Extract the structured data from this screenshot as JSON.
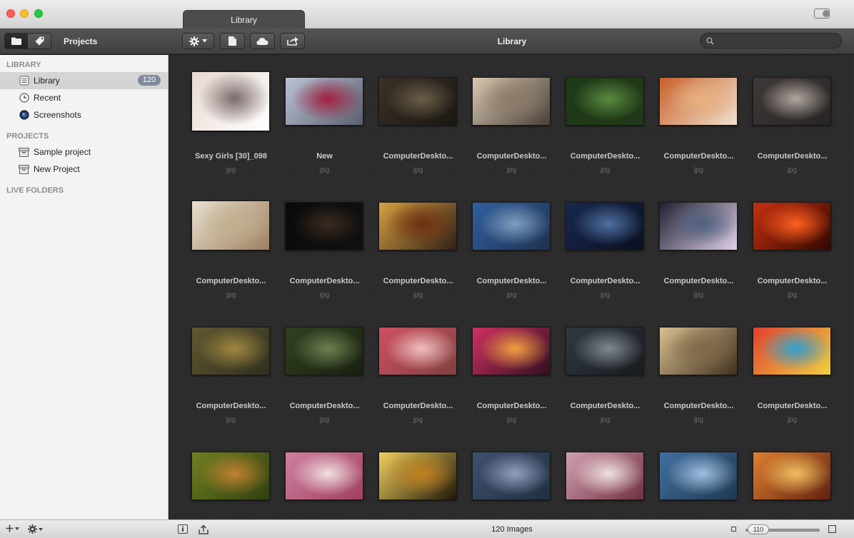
{
  "window": {
    "tab_title": "Library"
  },
  "toolbar": {
    "projects_label": "Projects",
    "title": "Library",
    "search_placeholder": ""
  },
  "sidebar": {
    "library_header": "LIBRARY",
    "library_items": [
      {
        "label": "Library",
        "badge": "120",
        "icon": "library-icon",
        "selected": true
      },
      {
        "label": "Recent",
        "icon": "clock-icon"
      },
      {
        "label": "Screenshots",
        "icon": "screenshots-icon"
      }
    ],
    "projects_header": "PROJECTS",
    "project_items": [
      {
        "label": "Sample project",
        "icon": "project-box-icon"
      },
      {
        "label": "New Project",
        "icon": "project-box-icon"
      }
    ],
    "live_folders_header": "LIVE FOLDERS"
  },
  "grid": {
    "items": [
      {
        "name": "Sexy Girls [30]_098",
        "ext": "jpg",
        "colors": [
          "#e8d8d0",
          "#7a6a6a",
          "#ffffff"
        ]
      },
      {
        "name": "New",
        "ext": "jpg",
        "colors": [
          "#bbc4d6",
          "#a02040",
          "#5a6070"
        ]
      },
      {
        "name": "ComputerDeskto...",
        "ext": "jpg",
        "colors": [
          "#3a3228",
          "#6b5e47",
          "#1a1612"
        ]
      },
      {
        "name": "ComputerDeskto...",
        "ext": "jpg",
        "colors": [
          "#d8c8b0",
          "#8a7a68",
          "#4a4038"
        ]
      },
      {
        "name": "ComputerDeskto...",
        "ext": "jpg",
        "colors": [
          "#1f3a18",
          "#5a8a40",
          "#203818"
        ]
      },
      {
        "name": "ComputerDeskto...",
        "ext": "jpg",
        "colors": [
          "#c86028",
          "#e8b080",
          "#f0e0d0"
        ]
      },
      {
        "name": "ComputerDeskto...",
        "ext": "jpg",
        "colors": [
          "#403838",
          "#b0a8a0",
          "#282424"
        ]
      },
      {
        "name": "ComputerDeskto...",
        "ext": "jpg",
        "colors": [
          "#e8e0d0",
          "#c0b090",
          "#a08060"
        ]
      },
      {
        "name": "ComputerDeskto...",
        "ext": "jpg",
        "colors": [
          "#0a0a0a",
          "#3a2a20",
          "#101010"
        ]
      },
      {
        "name": "ComputerDeskto...",
        "ext": "jpg",
        "colors": [
          "#d8a040",
          "#703010",
          "#302018"
        ]
      },
      {
        "name": "ComputerDeskto...",
        "ext": "jpg",
        "colors": [
          "#3060a0",
          "#80a0c0",
          "#203050"
        ]
      },
      {
        "name": "ComputerDeskto...",
        "ext": "jpg",
        "colors": [
          "#182850",
          "#5070a0",
          "#0a1020"
        ]
      },
      {
        "name": "ComputerDeskto...",
        "ext": "jpg",
        "colors": [
          "#202030",
          "#506080",
          "#e0d0e8"
        ]
      },
      {
        "name": "ComputerDeskto...",
        "ext": "jpg",
        "colors": [
          "#c83010",
          "#ff6020",
          "#300800"
        ]
      },
      {
        "name": "ComputerDeskto...",
        "ext": "jpg",
        "colors": [
          "#605830",
          "#a08840",
          "#303020"
        ]
      },
      {
        "name": "ComputerDeskto...",
        "ext": "jpg",
        "colors": [
          "#304020",
          "#708050",
          "#182010"
        ]
      },
      {
        "name": "ComputerDeskto...",
        "ext": "jpg",
        "colors": [
          "#d05060",
          "#f0c0c0",
          "#804040"
        ]
      },
      {
        "name": "ComputerDeskto...",
        "ext": "jpg",
        "colors": [
          "#d03060",
          "#f0a040",
          "#301020"
        ]
      },
      {
        "name": "ComputerDeskto...",
        "ext": "jpg",
        "colors": [
          "#303840",
          "#808890",
          "#181c20"
        ]
      },
      {
        "name": "ComputerDeskto...",
        "ext": "jpg",
        "colors": [
          "#d8c090",
          "#806848",
          "#403020"
        ]
      },
      {
        "name": "ComputerDeskto...",
        "ext": "jpg",
        "colors": [
          "#e04030",
          "#30a0d0",
          "#f0d040"
        ]
      },
      {
        "name": "ComputerDeskto...",
        "ext": "jpg",
        "colors": [
          "#708020",
          "#c08030",
          "#304010"
        ]
      },
      {
        "name": "ComputerDeskto...",
        "ext": "jpg",
        "colors": [
          "#d080a0",
          "#f0e0e0",
          "#a04060"
        ]
      },
      {
        "name": "ComputerDeskto...",
        "ext": "jpg",
        "colors": [
          "#f0d060",
          "#c08020",
          "#201808"
        ]
      },
      {
        "name": "ComputerDeskto...",
        "ext": "jpg",
        "colors": [
          "#405070",
          "#90a0c0",
          "#203040"
        ]
      },
      {
        "name": "ComputerDeskto...",
        "ext": "jpg",
        "colors": [
          "#d0a0b0",
          "#f0e0e0",
          "#703040"
        ]
      },
      {
        "name": "ComputerDeskto...",
        "ext": "jpg",
        "colors": [
          "#4070a0",
          "#a0c0e0",
          "#203850"
        ]
      },
      {
        "name": "ComputerDeskto...",
        "ext": "jpg",
        "colors": [
          "#e08030",
          "#f0c060",
          "#602010"
        ]
      }
    ]
  },
  "bottombar": {
    "status": "120 Images",
    "zoom_value": "110"
  }
}
